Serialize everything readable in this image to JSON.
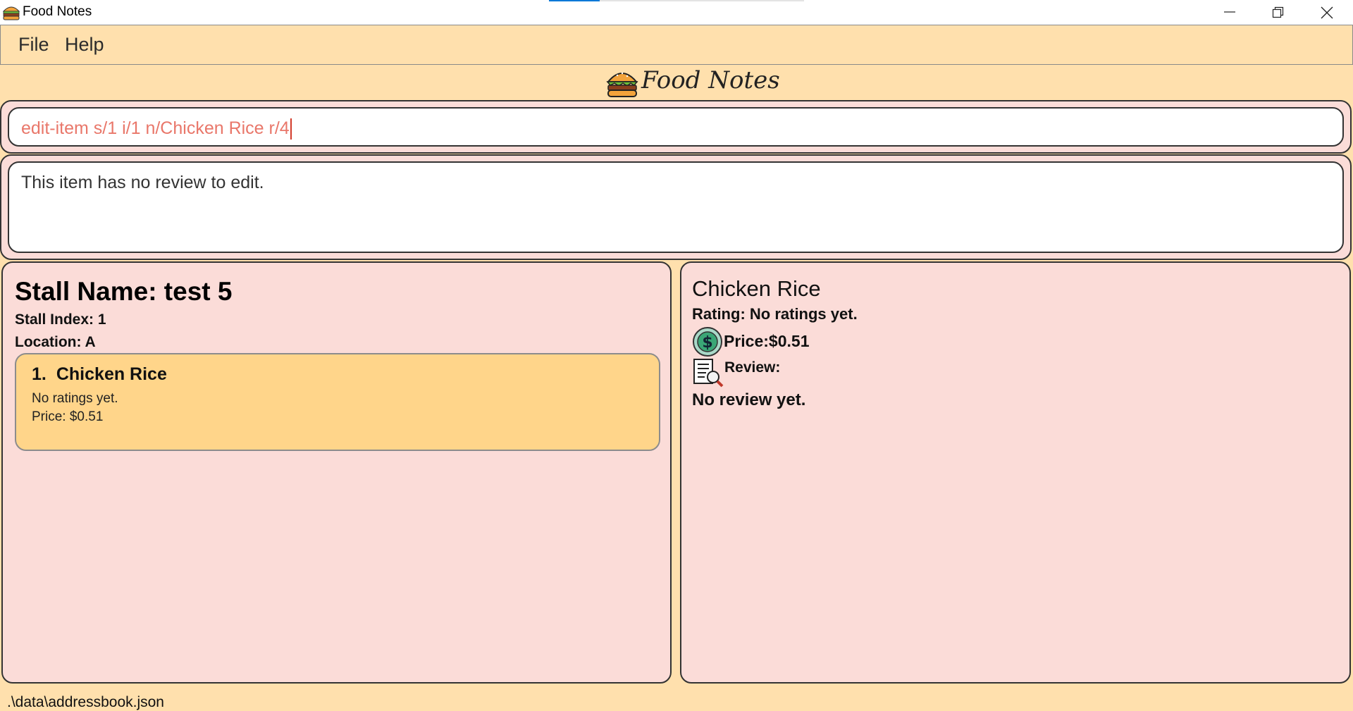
{
  "window": {
    "title": "Food Notes",
    "controls": [
      "minimize",
      "restore",
      "close"
    ]
  },
  "menu": {
    "file": "File",
    "help": "Help"
  },
  "logo": {
    "text": "Food Notes",
    "icon": "burger-icon"
  },
  "command_box": {
    "value": "edit-item s/1 i/1 n/Chicken Rice r/4"
  },
  "result_box": {
    "text": "This item has no review to edit."
  },
  "stall": {
    "name": "Stall Name: test 5",
    "index": "Stall Index: 1",
    "location": "Location: A",
    "items": [
      {
        "number": "1.",
        "name": "Chicken Rice",
        "rating": "No ratings yet.",
        "price": "Price: $0.51"
      }
    ]
  },
  "detail": {
    "name": "Chicken Rice",
    "rating": "Rating: No ratings yet.",
    "price": "Price:$0.51",
    "review_label": "Review:",
    "review": "No review yet."
  },
  "status_bar": {
    "path": ".\\data\\addressbook.json"
  },
  "colors": {
    "background": "#ffe0ad",
    "panel": "#fbdcd8",
    "card": "#ffd58a",
    "command_text": "#e9776a",
    "accent": "#0078d7"
  }
}
